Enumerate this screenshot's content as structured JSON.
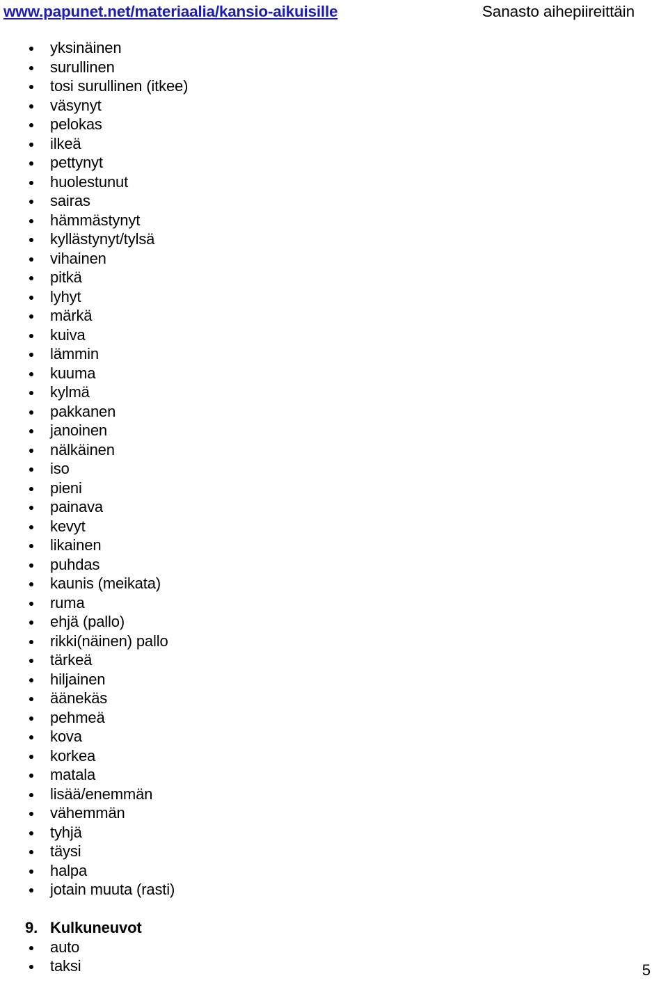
{
  "header": {
    "url": "www.papunet.net/materiaalia/kansio-aikuisille",
    "title": "Sanasto aihepiireittäin",
    "url_color": "#1c1cb4"
  },
  "document": {
    "items": [
      {
        "type": "bullet",
        "text": "yksinäinen"
      },
      {
        "type": "bullet",
        "text": "surullinen"
      },
      {
        "type": "bullet",
        "text": "tosi surullinen (itkee)"
      },
      {
        "type": "bullet",
        "text": "väsynyt"
      },
      {
        "type": "bullet",
        "text": "pelokas"
      },
      {
        "type": "bullet",
        "text": "ilkeä"
      },
      {
        "type": "bullet",
        "text": "pettynyt"
      },
      {
        "type": "bullet",
        "text": "huolestunut"
      },
      {
        "type": "bullet",
        "text": "sairas"
      },
      {
        "type": "bullet",
        "text": "hämmästynyt"
      },
      {
        "type": "bullet",
        "text": "kyllästynyt/tylsä"
      },
      {
        "type": "bullet",
        "text": "vihainen"
      },
      {
        "type": "bullet",
        "text": "pitkä"
      },
      {
        "type": "bullet",
        "text": "lyhyt"
      },
      {
        "type": "bullet",
        "text": "märkä"
      },
      {
        "type": "bullet",
        "text": "kuiva"
      },
      {
        "type": "bullet",
        "text": "lämmin"
      },
      {
        "type": "bullet",
        "text": "kuuma"
      },
      {
        "type": "bullet",
        "text": "kylmä"
      },
      {
        "type": "bullet",
        "text": "pakkanen"
      },
      {
        "type": "bullet",
        "text": "janoinen"
      },
      {
        "type": "bullet",
        "text": "nälkäinen"
      },
      {
        "type": "bullet",
        "text": "iso"
      },
      {
        "type": "bullet",
        "text": "pieni"
      },
      {
        "type": "bullet",
        "text": "painava"
      },
      {
        "type": "bullet",
        "text": "kevyt"
      },
      {
        "type": "bullet",
        "text": "likainen"
      },
      {
        "type": "bullet",
        "text": "puhdas"
      },
      {
        "type": "bullet",
        "text": "kaunis (meikata)"
      },
      {
        "type": "bullet",
        "text": "ruma"
      },
      {
        "type": "bullet",
        "text": "ehjä (pallo)"
      },
      {
        "type": "bullet",
        "text": "rikki(näinen) pallo"
      },
      {
        "type": "bullet",
        "text": "tärkeä"
      },
      {
        "type": "bullet",
        "text": "hiljainen"
      },
      {
        "type": "bullet",
        "text": "äänekäs"
      },
      {
        "type": "bullet",
        "text": "pehmeä"
      },
      {
        "type": "bullet",
        "text": "kova"
      },
      {
        "type": "bullet",
        "text": "korkea"
      },
      {
        "type": "bullet",
        "text": "matala"
      },
      {
        "type": "bullet",
        "text": "lisää/enemmän"
      },
      {
        "type": "bullet",
        "text": "vähemmän"
      },
      {
        "type": "bullet",
        "text": "tyhjä"
      },
      {
        "type": "bullet",
        "text": "täysi"
      },
      {
        "type": "bullet",
        "text": "halpa"
      },
      {
        "type": "bullet",
        "text": "jotain muuta (rasti)"
      },
      {
        "type": "spacer",
        "text": ""
      },
      {
        "type": "heading",
        "number": "9.",
        "text": "Kulkuneuvot"
      },
      {
        "type": "bullet",
        "text": "auto"
      },
      {
        "type": "bullet",
        "text": "taksi"
      }
    ]
  },
  "footer": {
    "page_number": "5"
  }
}
